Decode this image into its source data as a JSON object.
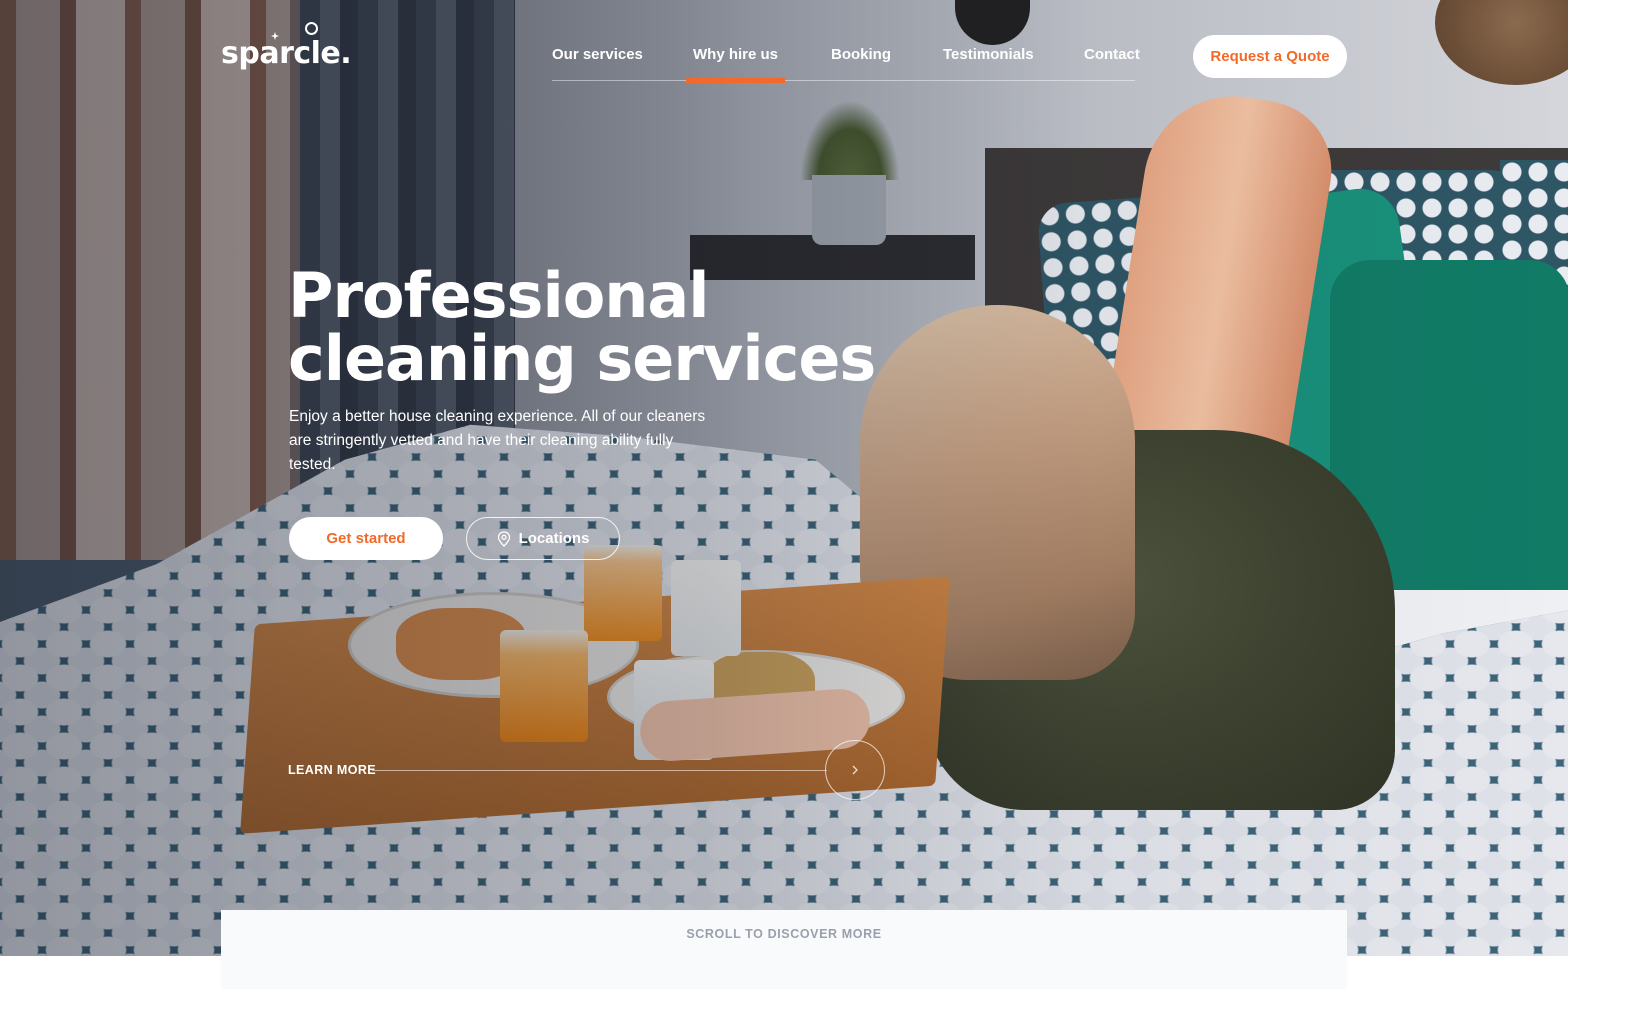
{
  "brand": {
    "logo_text": "sparcle."
  },
  "nav": {
    "items": [
      {
        "label": "Our services"
      },
      {
        "label": "Why hire us"
      },
      {
        "label": "Booking"
      },
      {
        "label": "Testimonials"
      },
      {
        "label": "Contact"
      }
    ],
    "active_item": "Why hire us",
    "cta_label": "Request a Quote"
  },
  "hero": {
    "title": "Professional cleaning services",
    "subtitle": "Enjoy a better house cleaning experience. All of our cleaners are stringently vetted and have their cleaning ability fully tested.",
    "primary_button": "Get started",
    "secondary_button": "Locations",
    "secondary_icon": "map-pin-icon",
    "learn_more_label": "LEARN MORE",
    "learn_more_icon": "chevron-right-icon"
  },
  "scroll_hint": {
    "label": "SCROLL TO DISCOVER MORE"
  },
  "colors": {
    "accent": "#f26a2a",
    "text_on_dark": "#ffffff",
    "muted": "#9aa0ab",
    "scroll_bg": "#f9fafc"
  }
}
